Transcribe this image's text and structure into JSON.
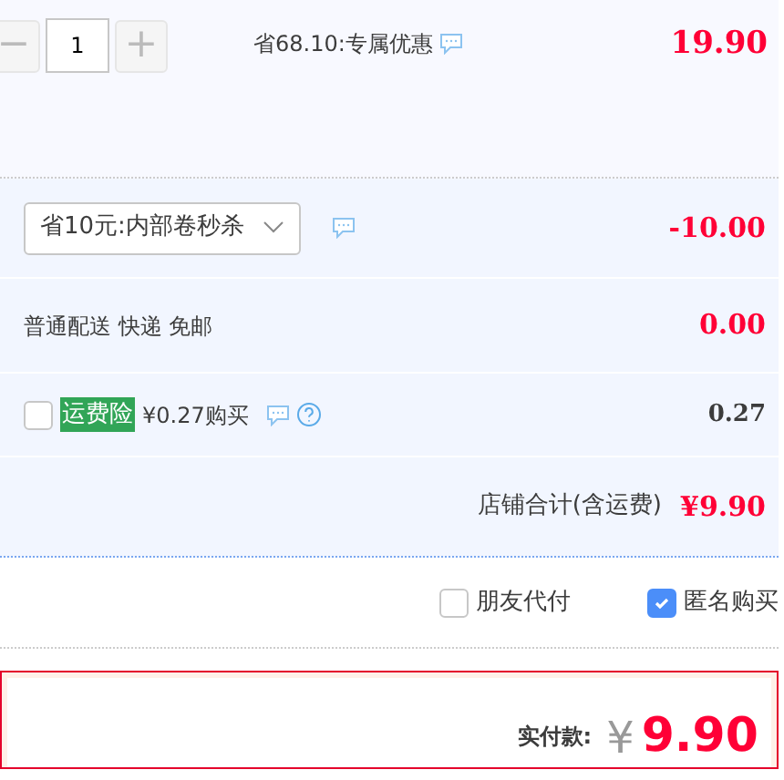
{
  "item": {
    "quantity": {
      "minus": "−",
      "value": "1",
      "plus": "+",
      "minus_disabled": true,
      "plus_disabled": true
    },
    "discount_note": "省68.10:专属优惠",
    "price": "19.90"
  },
  "promo": {
    "selected_option": "省10元:内部卷秒杀",
    "amount": "-10.00"
  },
  "shipping": {
    "label": "普通配送 快递 免邮",
    "amount": "0.00"
  },
  "insurance": {
    "checked": false,
    "tag": "运费险",
    "label": "¥0.27购买",
    "amount": "0.27"
  },
  "shop_total": {
    "label": "店铺合计(含运费)",
    "amount": "¥9.90"
  },
  "options": [
    {
      "label": "朋友代付",
      "checked": false
    },
    {
      "label": "匿名购买",
      "checked": true
    }
  ],
  "payment": {
    "label": "实付款:",
    "currency": "¥",
    "amount": "9.90"
  }
}
